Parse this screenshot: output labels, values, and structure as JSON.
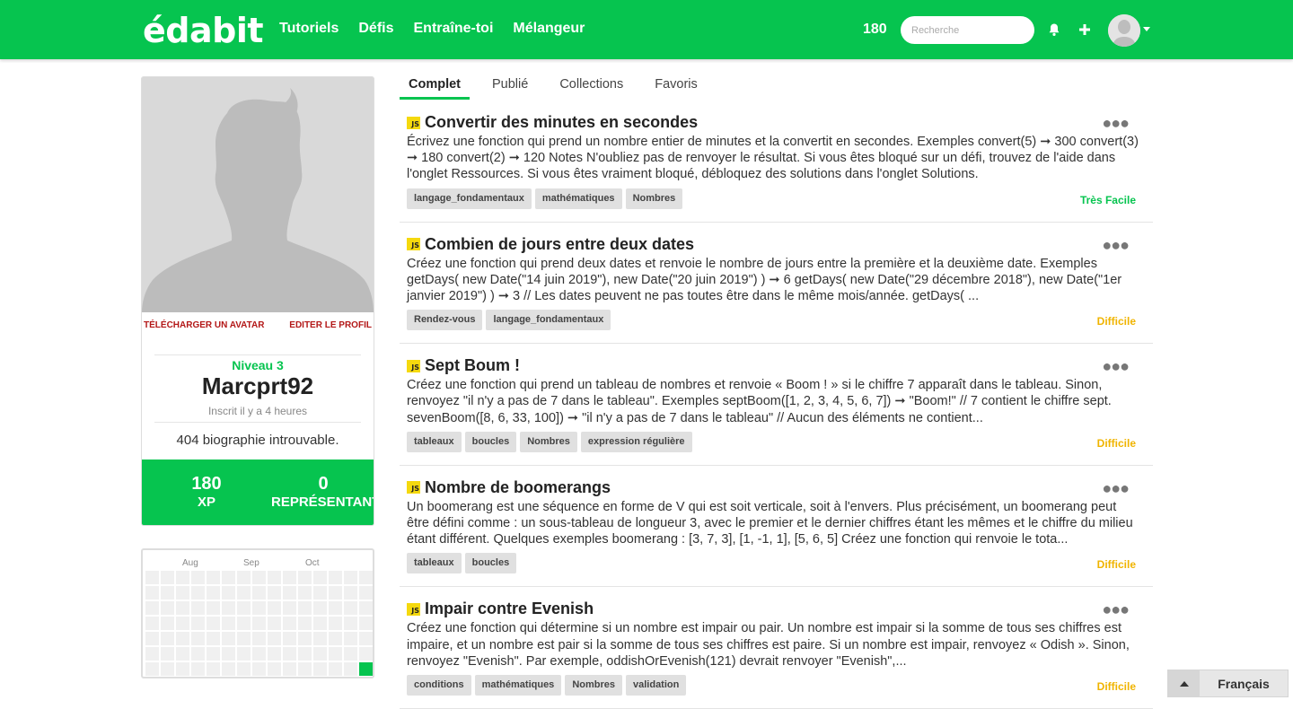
{
  "header": {
    "logo": "édabit",
    "nav": [
      "Tutoriels",
      "Défis",
      "Entraîne-toi",
      "Mélangeur"
    ],
    "xp": "180",
    "search_placeholder": "Recherche"
  },
  "profile": {
    "upload_avatar": "TÉLÉCHARGER UN AVATAR",
    "edit_profile": "EDITER LE PROFIL",
    "level": "Niveau 3",
    "username": "Marcprt92",
    "joined": "Inscrit il  y a 4 heures",
    "bio": "404 biographie introuvable.",
    "xp_value": "180",
    "xp_label": "XP",
    "rep_value": "0",
    "rep_label": "REPRÉSENTANT"
  },
  "heatmap": {
    "months": [
      "Aug",
      "Sep",
      "Oct"
    ],
    "active_cells": 1
  },
  "tabs": [
    "Complet",
    "Publié",
    "Collections",
    "Favoris"
  ],
  "challenges": [
    {
      "lang": "JS",
      "title": "Convertir des minutes en secondes",
      "description": "Écrivez une fonction qui prend un nombre entier de minutes et la convertit en secondes. Exemples convert(5) ➞ 300 convert(3) ➞ 180 convert(2) ➞ 120 Notes N'oubliez pas de renvoyer le résultat. Si vous êtes bloqué sur un défi, trouvez de l'aide dans l'onglet Ressources. Si vous êtes vraiment bloqué, débloquez des solutions dans l'onglet Solutions.",
      "tags": [
        "langage_fondamentaux",
        "mathématiques",
        "Nombres"
      ],
      "difficulty": "Très Facile",
      "level": "easy"
    },
    {
      "lang": "JS",
      "title": "Combien de jours entre deux dates",
      "description": "Créez une fonction qui prend deux dates et renvoie le nombre de jours entre la première et la deuxième date. Exemples getDays( new Date(\"14 juin 2019\"), new Date(\"20 juin 2019\") ) ➞ 6 getDays( new Date(\"29 décembre 2018\"), new Date(\"1er janvier 2019\") ) ➞ 3 // Les dates peuvent ne pas toutes être dans le même mois/année. getDays( ...",
      "tags": [
        "Rendez-vous",
        "langage_fondamentaux"
      ],
      "difficulty": "Difficile",
      "level": "hard"
    },
    {
      "lang": "JS",
      "title": "Sept Boum !",
      "description": "Créez une fonction qui prend un tableau de nombres et renvoie « Boom ! » si le chiffre 7 apparaît dans le tableau. Sinon, renvoyez \"il n'y a pas de 7 dans le tableau\". Exemples septBoom([1, 2, 3, 4, 5, 6, 7]) ➞ \"Boom!\" // 7 contient le chiffre sept. sevenBoom([8, 6, 33, 100]) ➞ \"il n'y a pas de 7 dans le tableau\" // Aucun des éléments ne contient...",
      "tags": [
        "tableaux",
        "boucles",
        "Nombres",
        "expression régulière"
      ],
      "difficulty": "Difficile",
      "level": "hard"
    },
    {
      "lang": "JS",
      "title": "Nombre de boomerangs",
      "description": "Un boomerang est une séquence en forme de V qui est soit verticale, soit à l'envers. Plus précisément, un boomerang peut être défini comme : un sous-tableau de longueur 3, avec le premier et le dernier chiffres étant les mêmes et le chiffre du milieu étant différent. Quelques exemples boomerang : [3, 7, 3], [1, -1, 1], [5, 6, 5] Créez une fonction qui renvoie le tota...",
      "tags": [
        "tableaux",
        "boucles"
      ],
      "difficulty": "Difficile",
      "level": "hard"
    },
    {
      "lang": "JS",
      "title": "Impair contre Evenish",
      "description": "Créez une fonction qui détermine si un nombre est impair ou pair. Un nombre est impair si la somme de tous ses chiffres est impaire, et un nombre est pair si la somme de tous ses chiffres est paire. Si un nombre est impair, renvoyez « Odish ». Sinon, renvoyez \"Evenish\". Par exemple, oddishOrEvenish(121) devrait renvoyer \"Evenish\",...",
      "tags": [
        "conditions",
        "mathématiques",
        "Nombres",
        "validation"
      ],
      "difficulty": "Difficile",
      "level": "hard"
    }
  ],
  "language_selector": "Français"
}
